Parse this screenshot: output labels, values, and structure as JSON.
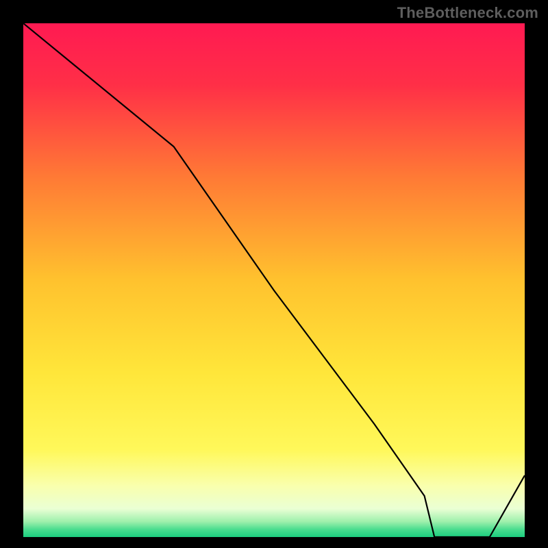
{
  "watermark": "TheBottleneck.com",
  "chart_data": {
    "type": "line",
    "x": [
      0.0,
      0.1,
      0.2,
      0.3,
      0.4,
      0.5,
      0.6,
      0.7,
      0.8,
      0.82,
      0.88,
      0.93,
      1.0
    ],
    "values": [
      100,
      92,
      84,
      76,
      62,
      48,
      35,
      22,
      8,
      0,
      0,
      0,
      12
    ],
    "title": "",
    "xlabel": "",
    "ylabel": "",
    "ylim": [
      0,
      100
    ],
    "xlim": [
      0,
      1
    ],
    "floor_label": "",
    "gradient_stops": [
      {
        "pos": 0.0,
        "color": "#ff1a52"
      },
      {
        "pos": 0.12,
        "color": "#ff2f47"
      },
      {
        "pos": 0.3,
        "color": "#ff7a35"
      },
      {
        "pos": 0.5,
        "color": "#ffc22e"
      },
      {
        "pos": 0.68,
        "color": "#ffe63a"
      },
      {
        "pos": 0.83,
        "color": "#fff85a"
      },
      {
        "pos": 0.9,
        "color": "#f9ffad"
      },
      {
        "pos": 0.945,
        "color": "#eaffd4"
      },
      {
        "pos": 0.97,
        "color": "#9ef0ac"
      },
      {
        "pos": 0.985,
        "color": "#4bdd8f"
      },
      {
        "pos": 1.0,
        "color": "#1bce7f"
      }
    ]
  }
}
